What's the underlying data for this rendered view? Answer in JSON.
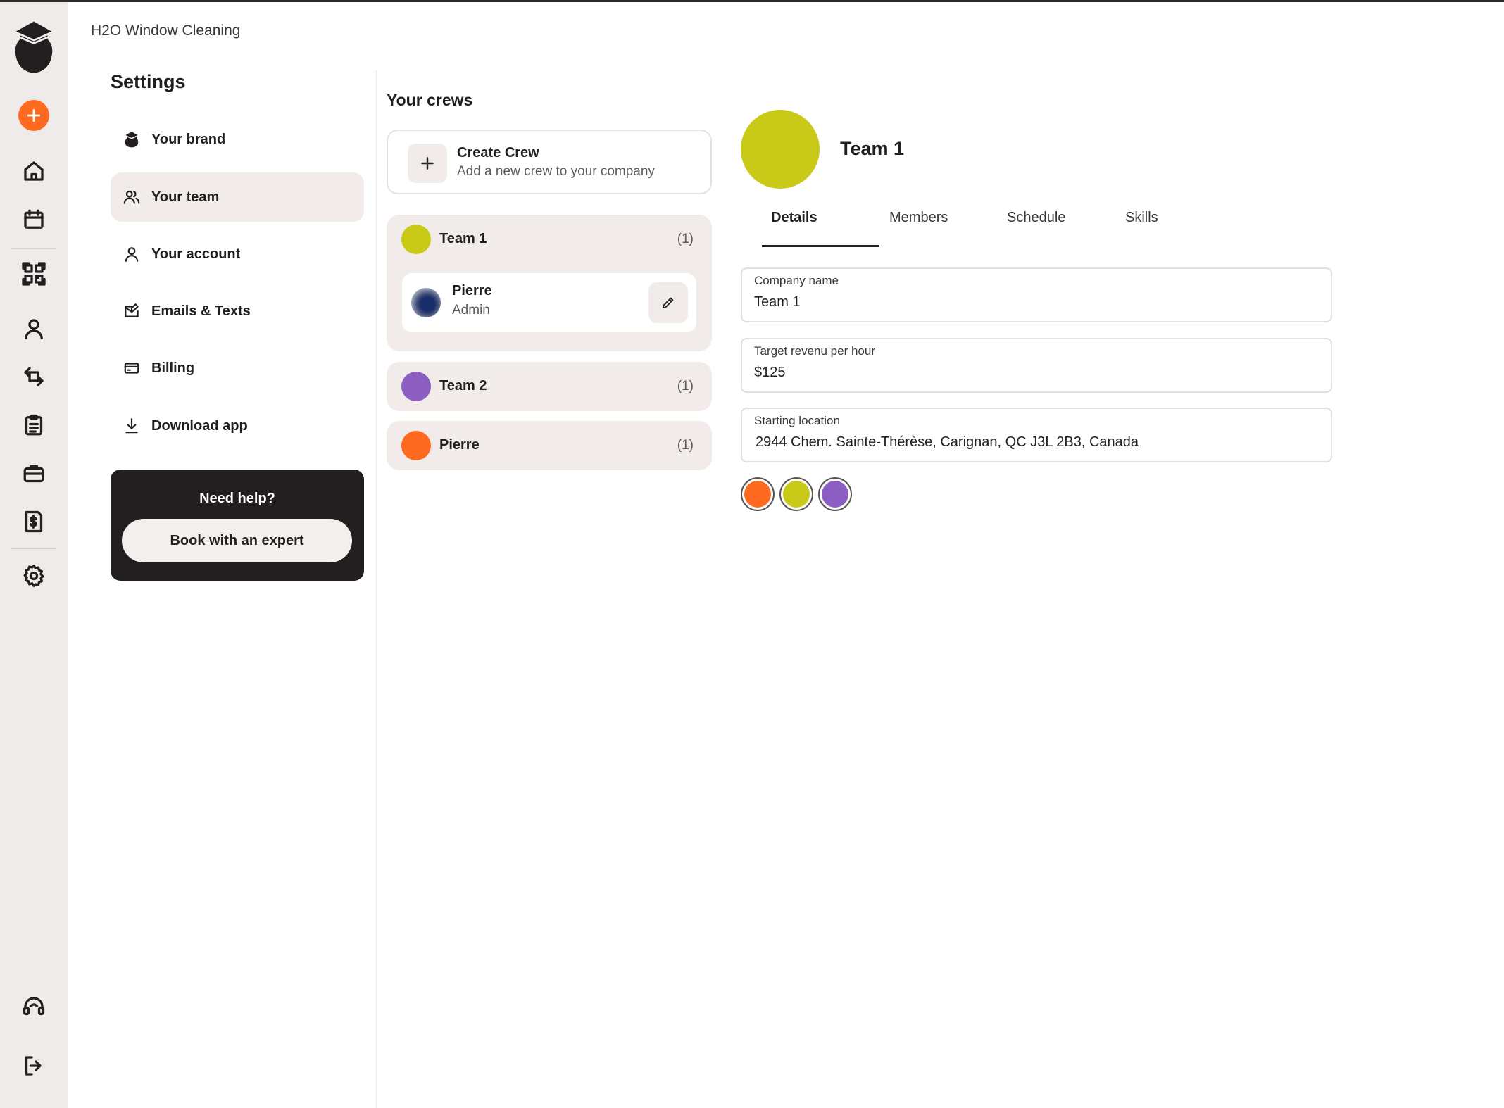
{
  "app": {
    "company_name": "H2O Window Cleaning"
  },
  "colors": {
    "accent_orange": "#ff6a21",
    "lime": "#c9c918",
    "purple": "#8c5ec1",
    "dark": "#231f20",
    "rail_bg": "#efebe8",
    "card_bg": "#f1ece9"
  },
  "rail": {
    "icons": [
      "logo-icon",
      "add-icon",
      "home-icon",
      "calendar-icon",
      "qr-code-icon",
      "user-icon",
      "repeat-icon",
      "clipboard-icon",
      "briefcase-icon",
      "invoice-icon",
      "gear-icon",
      "support-icon",
      "logout-icon"
    ]
  },
  "settings": {
    "title": "Settings",
    "items": [
      {
        "label": "Your brand",
        "icon": "brand-logo-icon"
      },
      {
        "label": "Your team",
        "icon": "team-icon",
        "active": true
      },
      {
        "label": "Your account",
        "icon": "user-icon"
      },
      {
        "label": "Emails & Texts",
        "icon": "mail-edit-icon"
      },
      {
        "label": "Billing",
        "icon": "credit-card-icon"
      },
      {
        "label": "Download app",
        "icon": "download-icon"
      }
    ],
    "help": {
      "title": "Need help?",
      "button": "Book with an expert"
    }
  },
  "crews": {
    "title": "Your crews",
    "create": {
      "title": "Create Crew",
      "subtitle": "Add a new crew to your company"
    },
    "list": [
      {
        "name": "Team 1",
        "count": "(1)",
        "color": "#c9c918",
        "expanded": true,
        "members": [
          {
            "name": "Pierre",
            "role": "Admin"
          }
        ]
      },
      {
        "name": "Team 2",
        "count": "(1)",
        "color": "#8c5ec1"
      },
      {
        "name": "Pierre",
        "count": "(1)",
        "color": "#ff6a21"
      }
    ]
  },
  "detail": {
    "title": "Team 1",
    "color": "#c9c918",
    "tabs": [
      "Details",
      "Members",
      "Schedule",
      "Skills"
    ],
    "active_tab": "Details",
    "fields": [
      {
        "label": "Company name",
        "value": "Team 1"
      },
      {
        "label": "Target revenu per hour",
        "value": "$125"
      },
      {
        "label": "Starting location",
        "value": "2944 Chem. Sainte-Thérèse, Carignan, QC J3L 2B3, Canada"
      }
    ],
    "color_options": [
      "#ff6a21",
      "#c9c918",
      "#8c5ec1"
    ]
  }
}
